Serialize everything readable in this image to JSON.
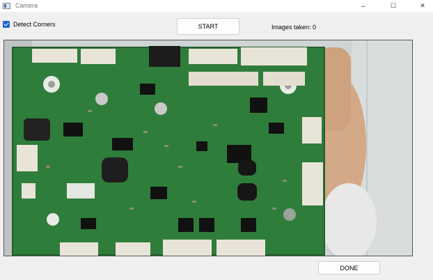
{
  "window": {
    "title": "Camera",
    "controls": {
      "minimize": "─",
      "maximize": "☐",
      "close": "✕"
    }
  },
  "controls": {
    "detect_corners_label": "Detect Corners",
    "detect_corners_checked": true,
    "start_label": "START",
    "images_taken_text": "Images taken: 0",
    "done_label": "DONE"
  },
  "camera_view": {
    "content": "live camera feed",
    "colors": {
      "board": "#2f7d3a",
      "hand": "#d4a987",
      "background": "#cfd4d4"
    }
  }
}
